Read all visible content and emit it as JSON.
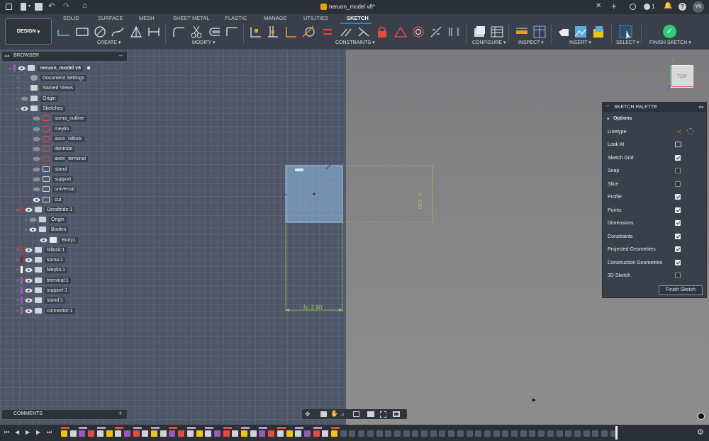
{
  "titlebar": {
    "doc_title": "neruon_model v8*",
    "notif_count": "1",
    "user_initials": "YK"
  },
  "tabs": [
    "SOLID",
    "SURFACE",
    "MESH",
    "SHEET METAL",
    "PLASTIC",
    "MANAGE",
    "UTILITIES",
    "SKETCH"
  ],
  "active_tab": "SKETCH",
  "workspace_label": "DESIGN",
  "groups": {
    "create": "CREATE",
    "modify": "MODIFY",
    "constraints": "CONSTRAINTS",
    "configure": "CONFIGURE",
    "inspect": "INSPECT",
    "insert": "INSERT",
    "select": "SELECT",
    "finish": "FINISH SKETCH"
  },
  "browser": {
    "title": "BROWSER",
    "root": "neruon_model v8",
    "items": [
      "Document Settings",
      "Named Views",
      "Origin",
      "Sketches",
      "soma_outline",
      "meylin",
      "axon_hillock",
      "dentride",
      "axon_terminal",
      "stand",
      "support",
      "universal",
      "cut",
      "Dendtride:1",
      "Origin",
      "Bodies",
      "Body1",
      "hillock:1",
      "soma:1",
      "Meylin:1",
      "terminal:1",
      "support:1",
      "stand:1",
      "connector:1"
    ]
  },
  "component_colors": [
    "#c0392b",
    "#c0392b",
    "#8e1f1f",
    "#ffffff",
    "#9b59b6",
    "#9b59b6",
    "#9b59b6",
    "#9b59b6"
  ],
  "comments_label": "COMMENTS",
  "viewcube": {
    "face": "TOP",
    "axis_x": "X",
    "axis_y": "Y",
    "axis_z": "Z"
  },
  "dimensions": {
    "horizontal": "fx: 2.90",
    "vertical": "fx: 2.90"
  },
  "palette": {
    "title": "SKETCH PALETTE",
    "section": "Options",
    "rows": [
      {
        "label": "Linetype",
        "type": "icons"
      },
      {
        "label": "Look At",
        "type": "icon"
      },
      {
        "label": "Sketch Grid",
        "checked": true
      },
      {
        "label": "Snap",
        "checked": false
      },
      {
        "label": "Slice",
        "checked": false
      },
      {
        "label": "Profile",
        "checked": true
      },
      {
        "label": "Points",
        "checked": true
      },
      {
        "label": "Dimensions",
        "checked": true
      },
      {
        "label": "Constraints",
        "checked": true
      },
      {
        "label": "Projected Geometries",
        "checked": true
      },
      {
        "label": "Construction Geometries",
        "checked": true
      },
      {
        "label": "3D Sketch",
        "checked": false
      }
    ],
    "finish_button": "Finish Sketch"
  },
  "colors": {
    "accent": "#0696d7",
    "finish_green": "#2ecc71",
    "sketch_blue": "#7fb3e6",
    "dim_green": "#9bd34a"
  }
}
